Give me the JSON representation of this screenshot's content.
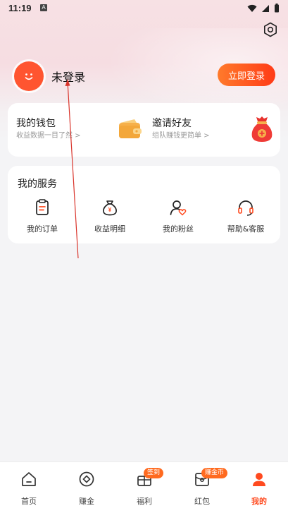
{
  "status_bar": {
    "time": "11:19",
    "app_icon": "A"
  },
  "profile": {
    "login_status": "未登录",
    "login_button": "立即登录"
  },
  "wallet": {
    "title": "我的钱包",
    "subtitle": "收益数据一目了然 >"
  },
  "invite": {
    "title": "邀请好友",
    "subtitle": "组队赚钱更简单 >"
  },
  "services": {
    "title": "我的服务",
    "items": [
      {
        "label": "我的订单",
        "icon": "order-icon"
      },
      {
        "label": "收益明细",
        "icon": "income-bag-icon"
      },
      {
        "label": "我的粉丝",
        "icon": "fans-icon"
      },
      {
        "label": "帮助&客服",
        "icon": "headset-icon"
      }
    ]
  },
  "tabbar": {
    "tabs": [
      {
        "label": "首页",
        "icon": "home-icon"
      },
      {
        "label": "赚金",
        "icon": "earn-icon"
      },
      {
        "label": "福利",
        "icon": "gift-icon",
        "badge": "签到"
      },
      {
        "label": "红包",
        "icon": "red-packet-icon",
        "badge": "赚金币"
      },
      {
        "label": "我的",
        "icon": "profile-icon",
        "active": true
      }
    ]
  },
  "colors": {
    "accent": "#ff4a1f",
    "button_gradient_start": "#ff7a2b",
    "button_gradient_end": "#ff3b17"
  }
}
